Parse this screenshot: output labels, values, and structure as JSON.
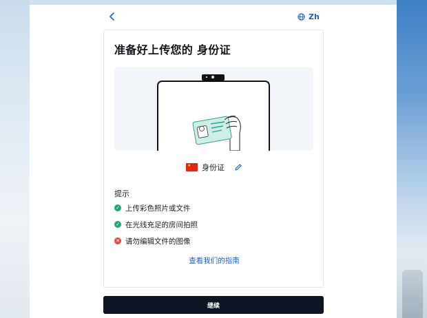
{
  "header": {
    "back_icon": "chevron-left-icon",
    "language_icon": "globe-icon",
    "language_label": "Zh"
  },
  "card": {
    "title": "准备好上传您的 身份证",
    "illustration": "phone-with-id-card-illustration",
    "document": {
      "flag": "china-flag-icon",
      "label": "身份证",
      "edit_icon": "pencil-icon"
    },
    "tips": {
      "title": "提示",
      "items": [
        {
          "label": "上传彩色照片或文件",
          "status": "ok",
          "icon": "check-circle-icon"
        },
        {
          "label": "在光线充足的房间拍照",
          "status": "ok",
          "icon": "check-circle-icon"
        },
        {
          "label": "请勿编辑文件的图像",
          "status": "bad",
          "icon": "x-circle-icon"
        }
      ]
    },
    "guide_link": "查看我们的指南"
  },
  "continue_label": "继续",
  "colors": {
    "accent": "#1a5fd6",
    "ok": "#1fa770",
    "error": "#e5484d",
    "button": "#0c1521"
  }
}
